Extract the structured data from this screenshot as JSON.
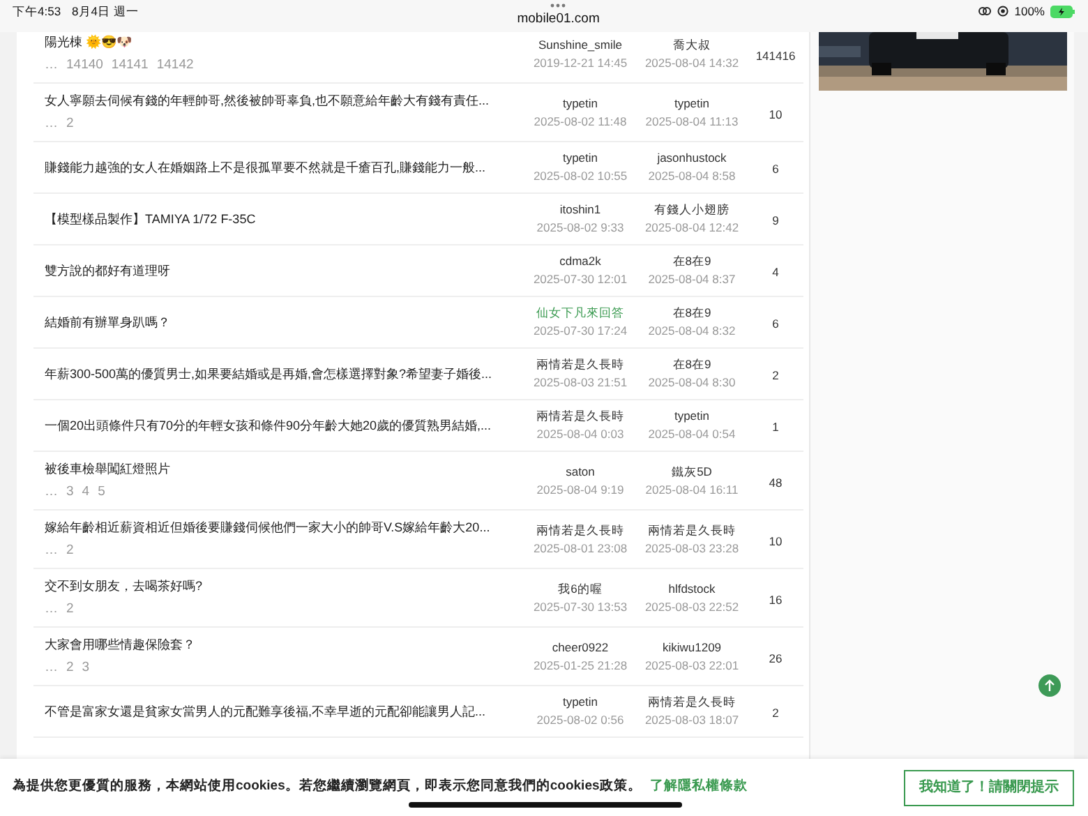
{
  "status_bar": {
    "time": "下午4:53",
    "date": "8月4日 週一",
    "url": "mobile01.com",
    "battery": "100%"
  },
  "topics": [
    {
      "title": "陽光棟 🌞😎🐶",
      "pages": [
        "…",
        "14140",
        "14141",
        "14142"
      ],
      "author": {
        "name": "Sunshine_smile",
        "date": "2019-12-21 14:45",
        "color": "#333333"
      },
      "last": {
        "name": "喬大叔",
        "date": "2025-08-04 14:32"
      },
      "replies": "141416"
    },
    {
      "title": "女人寧願去伺候有錢的年輕帥哥,然後被帥哥辜負,也不願意給年齡大有錢有責任...",
      "pages": [
        "…",
        "2"
      ],
      "author": {
        "name": "typetin",
        "date": "2025-08-02 11:48",
        "color": "#333333"
      },
      "last": {
        "name": "typetin",
        "date": "2025-08-04 11:13"
      },
      "replies": "10"
    },
    {
      "title": "賺錢能力越強的女人在婚姻路上不是很孤單要不然就是千瘡百孔,賺錢能力一般...",
      "author": {
        "name": "typetin",
        "date": "2025-08-02 10:55",
        "color": "#333333"
      },
      "last": {
        "name": "jasonhustock",
        "date": "2025-08-04 8:58"
      },
      "replies": "6"
    },
    {
      "title": "【模型樣品製作】TAMIYA 1/72 F-35C",
      "author": {
        "name": "itoshin1",
        "date": "2025-08-02 9:33",
        "color": "#333333"
      },
      "last": {
        "name": "有錢人小翅膀",
        "date": "2025-08-04 12:42"
      },
      "replies": "9"
    },
    {
      "title": "雙方說的都好有道理呀",
      "author": {
        "name": "cdma2k",
        "date": "2025-07-30 12:01",
        "color": "#333333"
      },
      "last": {
        "name": "在8在9",
        "date": "2025-08-04 8:37"
      },
      "replies": "4"
    },
    {
      "title": "結婚前有辦單身趴嗎？",
      "author": {
        "name": "仙女下凡來回答",
        "date": "2025-07-30 17:24",
        "color": "#3a9a50"
      },
      "last": {
        "name": "在8在9",
        "date": "2025-08-04 8:32"
      },
      "replies": "6"
    },
    {
      "title": "年薪300-500萬的優質男士,如果要結婚或是再婚,會怎樣選擇對象?希望妻子婚後...",
      "author": {
        "name": "兩情若是久長時",
        "date": "2025-08-03 21:51",
        "color": "#333333"
      },
      "last": {
        "name": "在8在9",
        "date": "2025-08-04 8:30"
      },
      "replies": "2"
    },
    {
      "title": "一個20出頭條件只有70分的年輕女孩和條件90分年齡大她20歲的優質熟男結婚,...",
      "author": {
        "name": "兩情若是久長時",
        "date": "2025-08-04 0:03",
        "color": "#333333"
      },
      "last": {
        "name": "typetin",
        "date": "2025-08-04 0:54"
      },
      "replies": "1"
    },
    {
      "title": "被後車檢舉闖紅燈照片",
      "pages": [
        "…",
        "3",
        "4",
        "5"
      ],
      "author": {
        "name": "saton",
        "date": "2025-08-04 9:19",
        "color": "#333333"
      },
      "last": {
        "name": "鐵灰5D",
        "date": "2025-08-04 16:11"
      },
      "replies": "48"
    },
    {
      "title": "嫁給年齡相近薪資相近但婚後要賺錢伺候他們一家大小的帥哥V.S嫁給年齡大20...",
      "pages": [
        "…",
        "2"
      ],
      "author": {
        "name": "兩情若是久長時",
        "date": "2025-08-01 23:08",
        "color": "#333333"
      },
      "last": {
        "name": "兩情若是久長時",
        "date": "2025-08-03 23:28"
      },
      "replies": "10"
    },
    {
      "title": "交不到女朋友，去喝茶好嗎?",
      "pages": [
        "…",
        "2"
      ],
      "author": {
        "name": "我6的喔",
        "date": "2025-07-30 13:53",
        "color": "#333333"
      },
      "last": {
        "name": "hlfdstock",
        "date": "2025-08-03 22:52"
      },
      "replies": "16"
    },
    {
      "title": "大家會用哪些情趣保險套？",
      "pages": [
        "…",
        "2",
        "3"
      ],
      "author": {
        "name": "cheer0922",
        "date": "2025-01-25 21:28",
        "color": "#333333"
      },
      "last": {
        "name": "kikiwu1209",
        "date": "2025-08-03 22:01"
      },
      "replies": "26"
    },
    {
      "title": "不管是富家女還是貧家女當男人的元配難享後福,不幸早逝的元配卻能讓男人記...",
      "author": {
        "name": "typetin",
        "date": "2025-08-02 0:56",
        "color": "#333333"
      },
      "last": {
        "name": "兩情若是久長時",
        "date": "2025-08-03 18:07"
      },
      "replies": "2"
    }
  ],
  "cookie_banner": {
    "text": "為提供您更優質的服務，本網站使用cookies。若您繼續瀏覽網頁，即表示您同意我們的cookies政策。",
    "link": "了解隱私權條款",
    "button": "我知道了！請關閉提示"
  }
}
